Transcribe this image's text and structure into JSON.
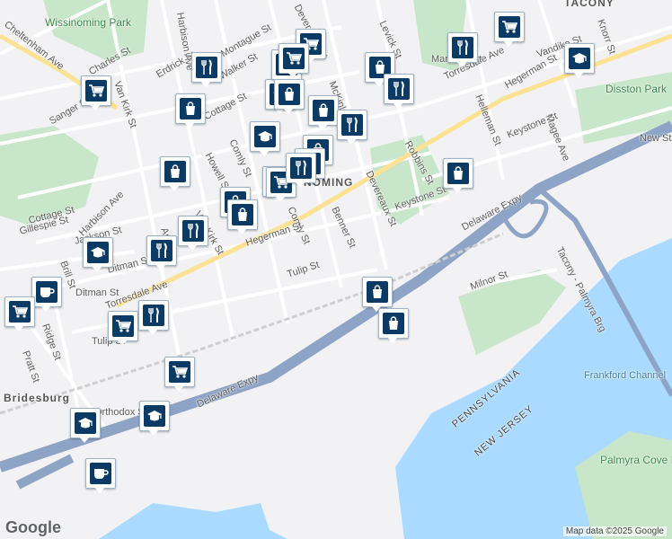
{
  "map": {
    "attribution": "Map data ©2025 Google",
    "logo_text": "Google",
    "labels": [
      {
        "text": "Wissinoming Park",
        "kind": "park"
      },
      {
        "text": "TACONY",
        "kind": "area"
      },
      {
        "text": "NOMING",
        "kind": "area"
      },
      {
        "text": "Disston Park",
        "kind": "park"
      },
      {
        "text": "Frankford Channel",
        "kind": "water"
      },
      {
        "text": "Palmyra Cove Nature Park",
        "kind": "park"
      },
      {
        "text": "PENNSYLVANIA",
        "kind": "state"
      },
      {
        "text": "NEW JERSEY",
        "kind": "state"
      },
      {
        "text": "Bridesburg",
        "kind": "area"
      },
      {
        "text": "Delaware Expy",
        "kind": "road"
      },
      {
        "text": "Delaware Expy",
        "kind": "road"
      },
      {
        "text": "Tacony - Palmyra Brg",
        "kind": "road"
      },
      {
        "text": "Cheltenham Ave",
        "kind": "road"
      },
      {
        "text": "Torresdale Ave",
        "kind": "road"
      },
      {
        "text": "Torresdale Ave",
        "kind": "road"
      },
      {
        "text": "Harbison Ave",
        "kind": "road"
      },
      {
        "text": "Harbison Ave",
        "kind": "road"
      },
      {
        "text": "Keystone St",
        "kind": "road"
      },
      {
        "text": "Keystone St",
        "kind": "road"
      },
      {
        "text": "Robbins St",
        "kind": "road"
      },
      {
        "text": "Levick St",
        "kind": "road"
      },
      {
        "text": "Devereaux St",
        "kind": "road"
      },
      {
        "text": "Devereaux St",
        "kind": "road"
      },
      {
        "text": "Benner St",
        "kind": "road"
      },
      {
        "text": "Comly St",
        "kind": "road"
      },
      {
        "text": "Comly St",
        "kind": "road"
      },
      {
        "text": "Hegerman St",
        "kind": "road"
      },
      {
        "text": "Hegerman St",
        "kind": "road"
      },
      {
        "text": "Tulip St",
        "kind": "road"
      },
      {
        "text": "Tulip St",
        "kind": "road"
      },
      {
        "text": "Milnor St",
        "kind": "road"
      },
      {
        "text": "Van Kirk St",
        "kind": "road"
      },
      {
        "text": "Van Kirk St",
        "kind": "road"
      },
      {
        "text": "Cottage St",
        "kind": "road"
      },
      {
        "text": "Cottage St",
        "kind": "road"
      },
      {
        "text": "Gillespie St",
        "kind": "road"
      },
      {
        "text": "Jackson St",
        "kind": "road"
      },
      {
        "text": "Ditman St",
        "kind": "road"
      },
      {
        "text": "Ditman St",
        "kind": "road"
      },
      {
        "text": "Howell St",
        "kind": "road"
      },
      {
        "text": "Walker St",
        "kind": "road"
      },
      {
        "text": "Montague St",
        "kind": "road"
      },
      {
        "text": "Erdrick St",
        "kind": "road"
      },
      {
        "text": "Sanger St",
        "kind": "road"
      },
      {
        "text": "Brill St",
        "kind": "road"
      },
      {
        "text": "Pratt St",
        "kind": "road"
      },
      {
        "text": "Helleman St",
        "kind": "road"
      },
      {
        "text": "Vandike St",
        "kind": "road"
      },
      {
        "text": "Magee Ave",
        "kind": "road"
      },
      {
        "text": "Knorr St",
        "kind": "road"
      },
      {
        "text": "New St",
        "kind": "road"
      },
      {
        "text": "Marsden St",
        "kind": "road"
      },
      {
        "text": "McKinley St",
        "kind": "road"
      },
      {
        "text": "Charles St",
        "kind": "road"
      },
      {
        "text": "Ridge St",
        "kind": "road"
      },
      {
        "text": "Orthodox St",
        "kind": "road"
      },
      {
        "text": "Ann St",
        "kind": "road"
      }
    ],
    "pins": [
      {
        "icon": "shopping-bag-icon"
      },
      {
        "icon": "grocery-cart-icon"
      },
      {
        "icon": "restaurant-icon"
      },
      {
        "icon": "school-icon"
      },
      {
        "icon": "coffee-icon"
      },
      {
        "icon": "shopping-bag-icon"
      },
      {
        "icon": "grocery-cart-icon"
      },
      {
        "icon": "restaurant-icon"
      },
      {
        "icon": "shopping-bag-icon"
      },
      {
        "icon": "school-icon"
      },
      {
        "icon": "grocery-cart-icon"
      },
      {
        "icon": "restaurant-icon"
      },
      {
        "icon": "shopping-bag-icon"
      },
      {
        "icon": "restaurant-icon"
      },
      {
        "icon": "shopping-bag-icon"
      },
      {
        "icon": "grocery-cart-icon"
      },
      {
        "icon": "restaurant-icon"
      },
      {
        "icon": "school-icon"
      },
      {
        "icon": "shopping-bag-icon"
      },
      {
        "icon": "restaurant-icon"
      },
      {
        "icon": "shopping-bag-icon"
      },
      {
        "icon": "school-icon"
      },
      {
        "icon": "grocery-cart-icon"
      },
      {
        "icon": "restaurant-icon"
      },
      {
        "icon": "restaurant-icon"
      },
      {
        "icon": "grocery-cart-icon"
      },
      {
        "icon": "shopping-bag-icon"
      },
      {
        "icon": "shopping-bag-icon"
      },
      {
        "icon": "grocery-cart-icon"
      },
      {
        "icon": "school-icon"
      },
      {
        "icon": "school-icon"
      },
      {
        "icon": "coffee-icon"
      },
      {
        "icon": "shopping-bag-icon"
      },
      {
        "icon": "restaurant-icon"
      },
      {
        "icon": "restaurant-icon"
      },
      {
        "icon": "shopping-bag-icon"
      },
      {
        "icon": "grocery-cart-icon"
      },
      {
        "icon": "school-icon"
      }
    ],
    "colors": {
      "water": "#aadaff",
      "park": "#c8e6c9",
      "highway": "#8ea4c6",
      "pin_glyph": "#0b3a64"
    }
  }
}
